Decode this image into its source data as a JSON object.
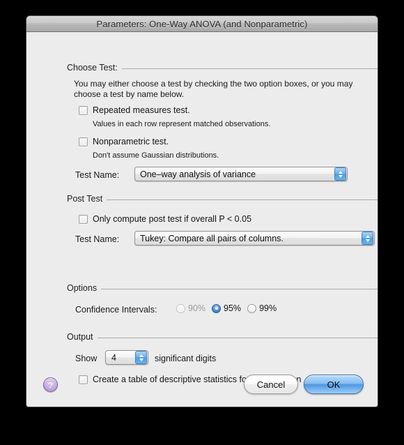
{
  "window": {
    "title": "Parameters: One-Way ANOVA (and Nonparametric)"
  },
  "choose_test": {
    "group_title": "Choose Test:",
    "description": "You may either choose a test by checking the two option boxes, or you may choose a test by name below.",
    "repeated_measures": {
      "label": "Repeated measures test.",
      "note": "Values in each row represent matched observations.",
      "checked": false
    },
    "nonparametric": {
      "label": "Nonparametric test.",
      "note": "Don't assume Gaussian distributions.",
      "checked": false
    },
    "test_name": {
      "label": "Test Name:",
      "value": "One–way analysis of variance"
    }
  },
  "post_test": {
    "group_title": "Post Test",
    "only_compute": {
      "label": "Only compute post test if overall P < 0.05",
      "checked": false
    },
    "test_name": {
      "label": "Test Name:",
      "value": "Tukey: Compare all pairs of columns."
    }
  },
  "options": {
    "group_title": "Options",
    "confidence_intervals": {
      "label": "Confidence Intervals:",
      "choices": [
        {
          "label": "90%",
          "selected": false,
          "disabled": true
        },
        {
          "label": "95%",
          "selected": true,
          "disabled": false
        },
        {
          "label": "99%",
          "selected": false,
          "disabled": false
        }
      ]
    }
  },
  "output": {
    "group_title": "Output",
    "show_label": "Show",
    "digits_value": "4",
    "digits_suffix": "significant digits",
    "descriptive_stats": {
      "label": "Create a table of descriptive statistics for each column",
      "checked": false
    }
  },
  "footer": {
    "help_glyph": "?",
    "cancel_label": "Cancel",
    "ok_label": "OK"
  },
  "colors": {
    "accent_blue": "#4e97e2",
    "help_purple": "#a98fd0",
    "window_bg": "#ececec"
  }
}
